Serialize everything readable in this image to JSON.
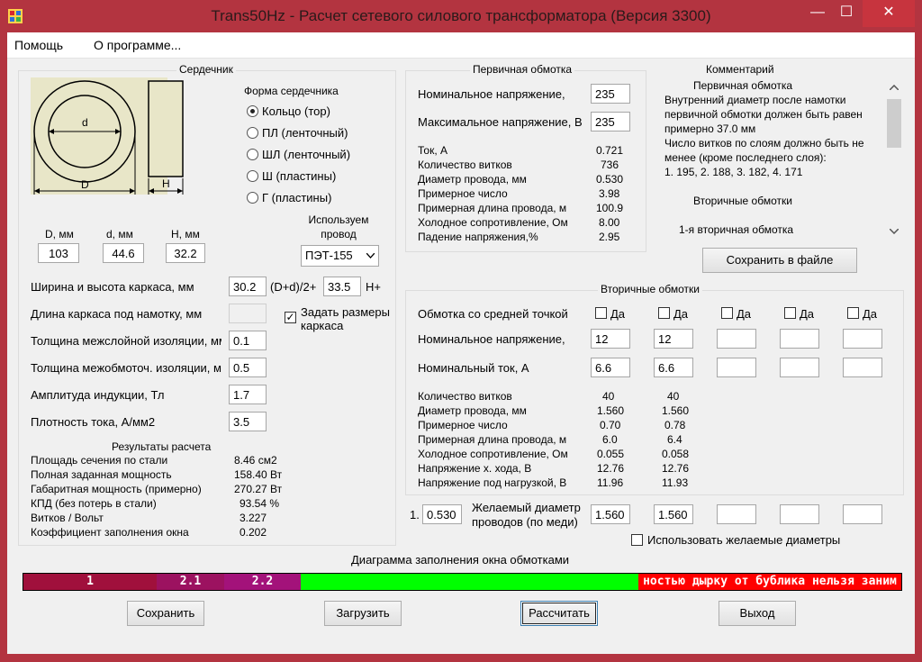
{
  "window": {
    "title": "Trans50Hz - Расчет сетевого силового трансформатора (Версия 3300)",
    "minimize": "—",
    "maximize": "☐",
    "close": "✕"
  },
  "menu": [
    "Помощь",
    "О программе..."
  ],
  "core": {
    "title": "Сердечник",
    "shape_title": "Форма сердечника",
    "shapes": [
      "Кольцо  (тор)",
      "ПЛ  (ленточный)",
      "ШЛ  (ленточный)",
      "Ш  (пластины)",
      "Г (пластины)"
    ],
    "selected_shape": 0,
    "dims": {
      "d_label": "d",
      "D_label": "D",
      "H_label": "H"
    },
    "D_label": "D, мм",
    "d_label": "d, мм",
    "H_label": "H, мм",
    "D_value": "103",
    "d_value": "44.6",
    "H_value": "32.2",
    "wire_label": "Используем провод",
    "wire_value": "ПЭТ-155",
    "frame_wh_label": "Ширина и высота каркаса, мм",
    "frame_w": "30.2",
    "frame_w_suffix": "(D+d)/2+",
    "frame_h": "33.5",
    "frame_h_suffix": "H+",
    "frame_len_label": "Длина каркаса под намотку, мм",
    "set_frame_label": "Задать размеры каркаса",
    "interlayer_label": "Толщина межслойной изоляции, мм",
    "interlayer": "0.1",
    "interwinding_label": "Толщина межобмоточ. изоляции, мм",
    "interwinding": "0.5",
    "induction_label": "Амплитуда индукции, Тл",
    "induction": "1.7",
    "current_density_label": "Плотность тока, А/мм2",
    "current_density": "3.5"
  },
  "results": {
    "title": "Результаты расчета",
    "rows": [
      {
        "label": "Площадь сечения по стали",
        "value": "8.46 см2"
      },
      {
        "label": "Полная заданная мощность",
        "value": "158.40 Вт"
      },
      {
        "label": "Габаритная мощность (примерно)",
        "value": "270.27 Вт"
      },
      {
        "label": "КПД (без потерь в стали)",
        "value": "93.54 %"
      },
      {
        "label": "Витков / Вольт",
        "value": "3.227"
      },
      {
        "label": "Коэффициент заполнения окна",
        "value": "0.202"
      }
    ]
  },
  "primary": {
    "title": "Первичная обмотка",
    "nominal_label": "Номинальное напряжение,",
    "nominal": "235",
    "max_label": "Максимальное напряжение, В",
    "max": "235",
    "rows": [
      {
        "label": "Ток, А",
        "value": "0.721"
      },
      {
        "label": "Количество витков",
        "value": "736"
      },
      {
        "label": "Диаметр провода, мм",
        "value": "0.530"
      },
      {
        "label": "Примерное число",
        "value": "3.98"
      },
      {
        "label": "Примерная длина провода, м",
        "value": "100.9"
      },
      {
        "label": "Холодное сопротивление, Ом",
        "value": "8.00"
      },
      {
        "label": "Падение напряжения,%",
        "value": "2.95"
      }
    ]
  },
  "comment": {
    "title": "Комментарий",
    "lines": [
      "Первичная обмотка",
      "Внутренний диаметр после намотки",
      "первичной обмотки должен быть равен",
      "примерно 37.0 мм",
      "Число витков по слоям должно быть не",
      "менее (кроме последнего слоя):",
      "1. 195,  2. 188,  3. 182,  4. 171",
      "",
      "Вторичные обмотки",
      "",
      "1-я вторичная обмотка"
    ],
    "save_button": "Сохранить в файле"
  },
  "secondary": {
    "title": "Вторичные обмотки",
    "center_tap_label": "Обмотка со средней точкой",
    "yes": "Да",
    "nominal_label": "Номинальное напряжение,",
    "current_label": "Номинальный ток, А",
    "nominal": [
      "12",
      "12",
      "",
      "",
      ""
    ],
    "current": [
      "6.6",
      "6.6",
      "",
      "",
      ""
    ],
    "row_labels": [
      "Количество витков",
      "Диаметр провода, мм",
      "Примерное число",
      "Примерная длина провода, м",
      "Холодное сопротивление, Ом",
      "Напряжение х. хода, В",
      "Напряжение под нагрузкой, В"
    ],
    "col1": [
      "40",
      "1.560",
      "0.70",
      "6.0",
      "0.055",
      "12.76",
      "11.96"
    ],
    "col2": [
      "40",
      "1.560",
      "0.78",
      "6.4",
      "0.058",
      "12.76",
      "11.93"
    ]
  },
  "desired": {
    "index": "1.",
    "primary_value": "0.530",
    "label": "Желаемый диаметр проводов  (по меди)",
    "values": [
      "1.560",
      "1.560",
      "",
      "",
      ""
    ],
    "use_label": "Использовать желаемые диаметры"
  },
  "diagram": {
    "title": "Диаграмма заполнения окна обмотками",
    "segments": [
      {
        "label": "1",
        "color": "#a0103c",
        "fraction": 0.152
      },
      {
        "label": "2.1",
        "color": "#9c1260",
        "fraction": 0.077
      },
      {
        "label": "2.2",
        "color": "#a3127a",
        "fraction": 0.087
      },
      {
        "label": "",
        "color": "#00ff00",
        "fraction": 0.385
      },
      {
        "label": "ностью дырку от бублика нельзя заним",
        "color": "#ff0000",
        "fraction": 0.299
      }
    ]
  },
  "buttons": {
    "save": "Сохранить",
    "load": "Загрузить",
    "calc": "Рассчитать",
    "exit": "Выход"
  }
}
